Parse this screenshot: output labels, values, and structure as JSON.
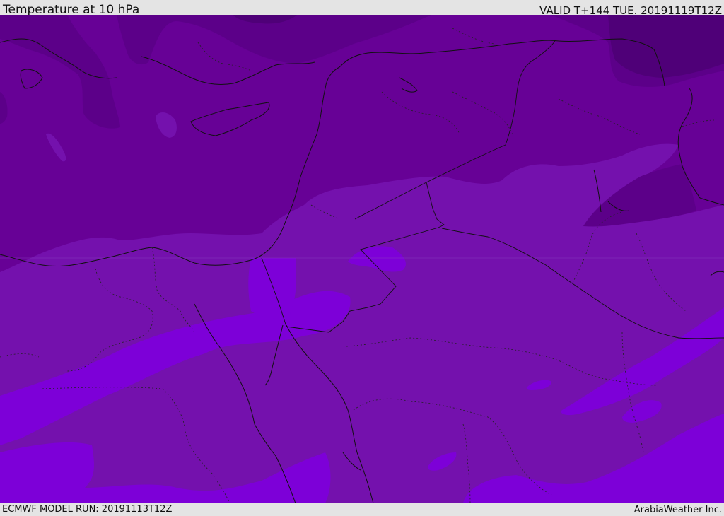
{
  "header": {
    "title": "Temperature at 10 hPa",
    "valid_time": "VALID T+144 TUE. 20191119T12Z"
  },
  "footer": {
    "model_run": "ECMWF MODEL RUN: 20191113T12Z",
    "credit": "ArabiaWeather Inc."
  },
  "map": {
    "variable": "temperature",
    "pressure_level": "10 hPa",
    "temperature_band_colors": [
      "#4f0078",
      "#5c0089",
      "#670196",
      "#7411ad",
      "#7d00d8"
    ],
    "border_color": "#111111"
  }
}
